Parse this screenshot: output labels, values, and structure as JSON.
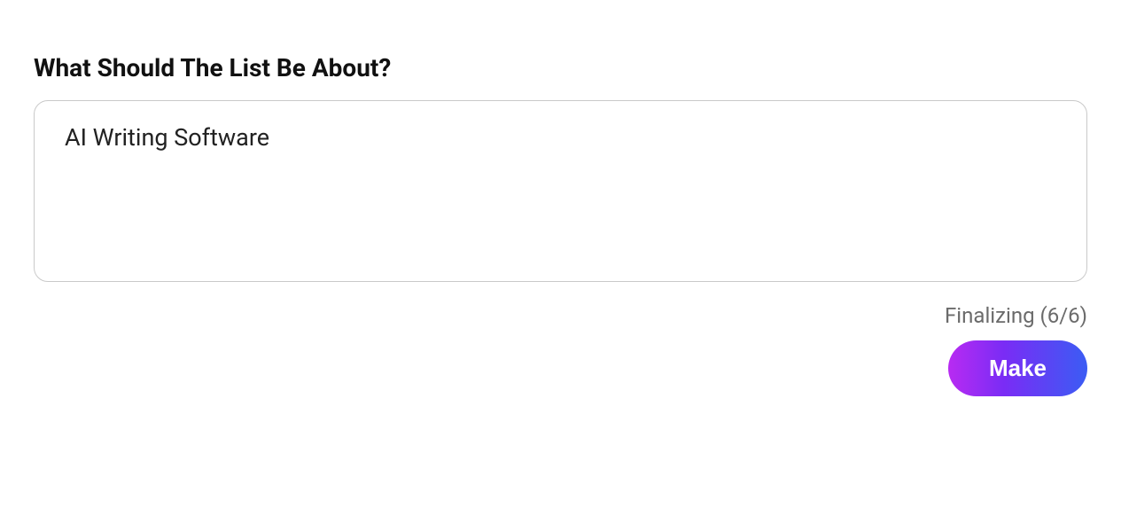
{
  "form": {
    "heading": "What Should The List Be About?",
    "input_value": "AI Writing Software",
    "status_text": "Finalizing (6/6)",
    "make_label": "Make"
  }
}
